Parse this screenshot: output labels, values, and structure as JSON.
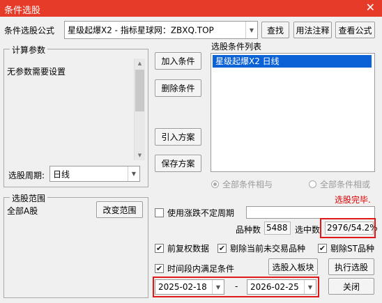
{
  "window": {
    "title": "条件选股",
    "close_glyph": "✕"
  },
  "formula": {
    "label": "条件选股公式",
    "value": "星级起爆X2  -  指标星球网：ZBXQ.TOP",
    "buttons": {
      "find": "查找",
      "usage": "用法注释",
      "view": "查看公式"
    }
  },
  "params": {
    "legend": "计算参数",
    "message": "无参数需要设置",
    "period_label": "选股周期:",
    "period_value": "日线"
  },
  "actions": {
    "add": "加入条件",
    "delete": "删除条件",
    "import": "引入方案",
    "save": "保存方案"
  },
  "conditions": {
    "legend": "选股条件列表",
    "items": [
      "星级起爆X2  日线"
    ],
    "radio_and": "全部条件相与",
    "radio_or": "全部条件相或"
  },
  "status": {
    "text": "选股完毕."
  },
  "range": {
    "legend": "选股范围",
    "value": "全部A股",
    "change_button": "改变范围"
  },
  "uncertain_period": {
    "label": "使用涨跌不定周期",
    "value": ""
  },
  "stats": {
    "count_label": "品种数",
    "count_value": "5488",
    "selected_label": "选中数",
    "selected_value": "2976/54.2%"
  },
  "options": {
    "adjusted": "前复权数据",
    "exclude_untraded": "剔除当前未交易品种",
    "exclude_st": "剔除ST品种",
    "time_range": "时间段内满足条件"
  },
  "dates": {
    "start": "2025-02-18",
    "separator": "-",
    "end": "2026-02-25"
  },
  "bottom_buttons": {
    "to_block": "选股入板块",
    "execute": "执行选股",
    "close": "关闭"
  },
  "colors": {
    "title_bar": "#e73b2a",
    "highlight_border": "#e21818",
    "status_red": "#e00000",
    "selected_item": "#0b62d6"
  }
}
